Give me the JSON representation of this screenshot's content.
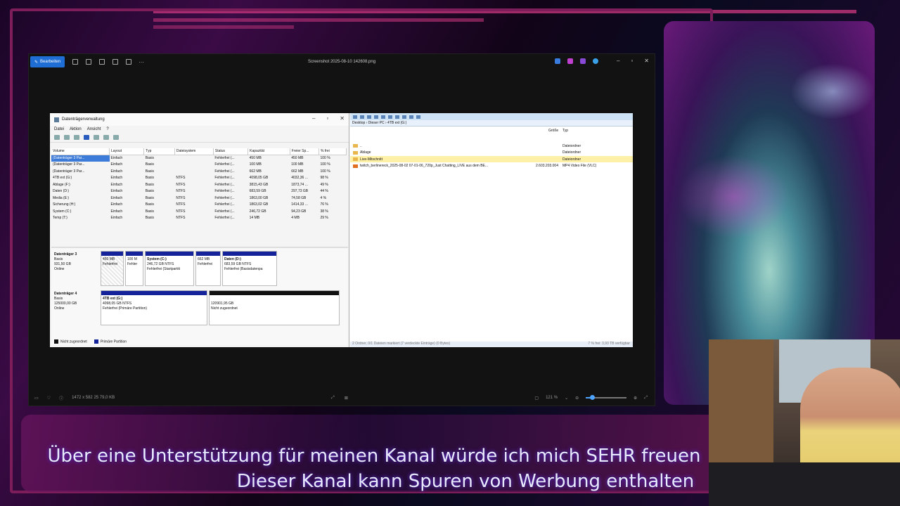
{
  "viewer": {
    "edit_label": "Bearbeiten",
    "title": "Screenshot 2025-08-10 142608.png",
    "zoom": "121 %",
    "zoom_fraction": 0.15,
    "file_info": "1472 x 582   25   79,0 KB"
  },
  "disk_mgmt": {
    "title": "Datenträgerverwaltung",
    "menu": [
      "Datei",
      "Aktion",
      "Ansicht",
      "?"
    ],
    "columns": [
      "Volume",
      "Layout",
      "Typ",
      "Dateisystem",
      "Status",
      "Kapazität",
      "Freier Sp...",
      "% frei"
    ],
    "rows": [
      [
        "(Datenträger 3 Par...",
        "Einfach",
        "Basis",
        "",
        "Fehlerfrei (...",
        "450 MB",
        "450 MB",
        "100 %"
      ],
      [
        "(Datenträger 3 Par...",
        "Einfach",
        "Basis",
        "",
        "Fehlerfrei (...",
        "100 MB",
        "100 MB",
        "100 %"
      ],
      [
        "(Datenträger 3 Par...",
        "Einfach",
        "Basis",
        "",
        "Fehlerfrei (...",
        "662 MB",
        "662 MB",
        "100 %"
      ],
      [
        "4TB ext (G:)",
        "Einfach",
        "Basis",
        "NTFS",
        "Fehlerfrei (...",
        "4098,05 GB",
        "4032,36 ...",
        "98 %"
      ],
      [
        "Ablage (F:)",
        "Einfach",
        "Basis",
        "NTFS",
        "Fehlerfrei (...",
        "3815,43 GB",
        "1873,74 ...",
        "49 %"
      ],
      [
        "Daten (D:)",
        "Einfach",
        "Basis",
        "NTFS",
        "Fehlerfrei (...",
        "683,59 GB",
        "297,73 GB",
        "44 %"
      ],
      [
        "Media (E:)",
        "Einfach",
        "Basis",
        "NTFS",
        "Fehlerfrei (...",
        "1863,00 GB",
        "74,58 GB",
        "4 %"
      ],
      [
        "Sicherung (H:)",
        "Einfach",
        "Basis",
        "NTFS",
        "Fehlerfrei (...",
        "1863,02 GB",
        "1414,33 ...",
        "76 %"
      ],
      [
        "System (C:)",
        "Einfach",
        "Basis",
        "NTFS",
        "Fehlerfrei (...",
        "246,72 GB",
        "94,23 GB",
        "38 %"
      ],
      [
        "Temp (T:)",
        "Einfach",
        "Basis",
        "NTFS",
        "Fehlerfrei (...",
        "14 MB",
        "4 MB",
        "29 %"
      ]
    ],
    "disk3": {
      "name": "Datenträger 3",
      "type": "Basis",
      "size": "931,50 GB",
      "state": "Online",
      "parts": [
        {
          "name": "",
          "size": "450 MB",
          "status": "Fehlerfrei"
        },
        {
          "name": "",
          "size": "100 M",
          "status": "Fehler"
        },
        {
          "name": "System (C:)",
          "size": "246,72 GB NTFS",
          "status": "Fehlerfrei (Startpartiti"
        },
        {
          "name": "",
          "size": "662 MB",
          "status": "Fehlerfrei"
        },
        {
          "name": "Daten (D:)",
          "size": "683,59 GB NTFS",
          "status": "Fehlerfrei (Basisdatenpa"
        }
      ]
    },
    "disk4": {
      "name": "Datenträger 4",
      "type": "Basis",
      "size": "125000,00 GB",
      "state": "Online",
      "parts": [
        {
          "name": "4TB ext (G:)",
          "size": "4098,05 GB NTFS",
          "status": "Fehlerfrei (Primäre Partition)"
        },
        {
          "name": "",
          "size": "120901,95 GB",
          "status": "Nicht zugeordnet"
        }
      ]
    },
    "legend": [
      "Nicht zugeordnet",
      "Primäre Partition"
    ]
  },
  "explorer": {
    "address": "Desktop  ›  Dieser PC  ›  4TB ext (G:)",
    "columns": [
      "Größe",
      "Typ"
    ],
    "rows": [
      {
        "name": "..",
        "size": "",
        "type": "Dateiordner"
      },
      {
        "name": "Ablage",
        "size": "",
        "type": "Dateiordner"
      },
      {
        "name": "Live-Mitschnitt",
        "size": "",
        "type": "Dateiordner"
      },
      {
        "name": "twitch_berlinereck_2025-08-02 07-01-06_720p_Just Chatting_LIVE aus dem BE...",
        "size": "2.603.203.004",
        "type": "MP4 Video File (VLC)"
      }
    ],
    "status_left": "2 Ordner, 0/1 Dateien markiert (7 verdeckte Einträge) (0 Bytes)",
    "status_right": "7 % frei: 3,93 TB verfügbar"
  },
  "subtitles": {
    "line1": "Über eine Unterstützung für meinen Kanal würde ich mich SEHR freuen",
    "line2": "Dieser Kanal kann Spuren von Werbung enthalten"
  }
}
